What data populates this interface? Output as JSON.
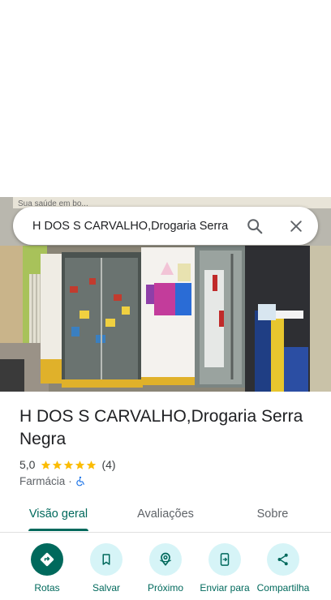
{
  "search": {
    "query": "H DOS S CARVALHO,Drogaria Serra"
  },
  "place": {
    "name": "H DOS S CARVALHO,Drogaria Serra Negra",
    "rating": "5,0",
    "stars": 5,
    "review_count": "(4)",
    "category": "Farmácia",
    "separator": "·"
  },
  "photo": {
    "sign_text": "Sua saúde em bo..."
  },
  "tabs": [
    {
      "label": "Visão geral",
      "active": true
    },
    {
      "label": "Avaliações"
    },
    {
      "label": "Sobre"
    }
  ],
  "actions": [
    {
      "label": "Rotas",
      "icon": "directions-icon"
    },
    {
      "label": "Salvar",
      "icon": "bookmark-icon"
    },
    {
      "label": "Próximo",
      "icon": "nearby-icon"
    },
    {
      "label": "Enviar para",
      "icon": "send-to-phone-icon"
    },
    {
      "label": "Compartilha",
      "icon": "share-icon"
    }
  ],
  "colors": {
    "accent": "#00695c",
    "star": "#fbbc04",
    "action_bg": "#d6f4f7"
  }
}
